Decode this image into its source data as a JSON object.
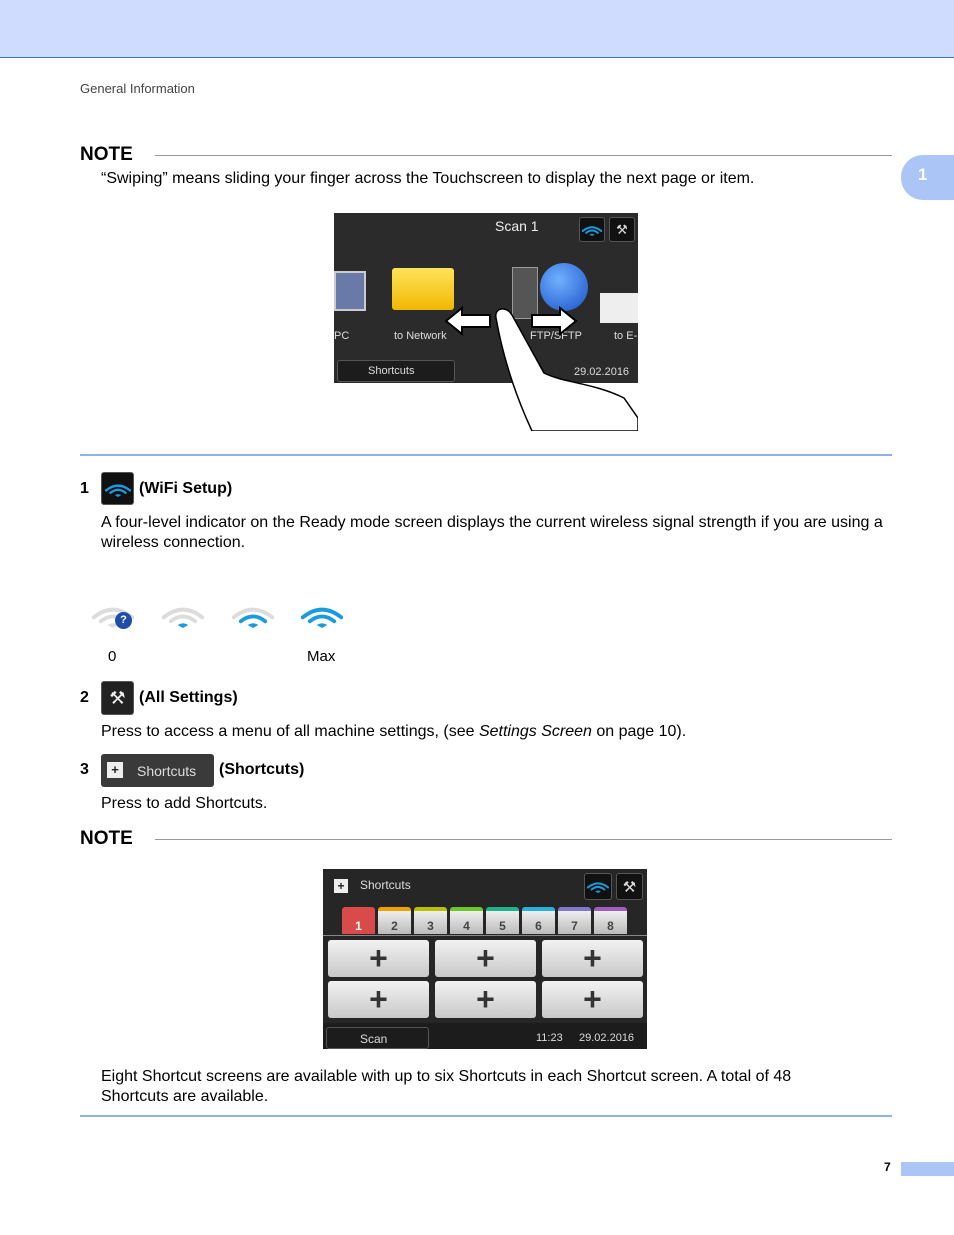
{
  "header": {
    "breadcrumb": "General Information",
    "chapter_tab": "1"
  },
  "note1": {
    "title": "NOTE",
    "text": "“Swiping” means sliding your finger across the Touchscreen to display the next page or item.",
    "screen": {
      "title": "Scan 1",
      "items": [
        "PC",
        "to Network",
        "FTP/SFTP",
        "to E-mail Server"
      ],
      "shortcuts_label": "Shortcuts",
      "date": "29.02.2016"
    }
  },
  "items": [
    {
      "number": "1",
      "icon": "wifi-icon",
      "title": "(WiFi Setup)",
      "text": "A four-level indicator on the Ready mode screen displays the current wireless signal strength if you are using a wireless connection.",
      "levels": [
        0,
        1,
        2,
        3
      ],
      "scale_min": "0",
      "scale_max": "Max"
    },
    {
      "number": "2",
      "icon": "settings-tools-icon",
      "title": "(All Settings)",
      "text_before": "Press to access a menu of all machine settings, (see ",
      "text_link": "Settings Screen",
      "text_after": " on page 10)."
    },
    {
      "number": "3",
      "icon": "shortcuts-icon",
      "button_label": "Shortcuts",
      "title": "(Shortcuts)",
      "text": "Press to add Shortcuts."
    }
  ],
  "note2": {
    "title": "NOTE",
    "screen": {
      "title": "Shortcuts",
      "tabs": [
        {
          "label": "1",
          "color": "#d94a4a"
        },
        {
          "label": "2",
          "color": "#f0a000"
        },
        {
          "label": "3",
          "color": "#b8c000"
        },
        {
          "label": "4",
          "color": "#6cc82a"
        },
        {
          "label": "5",
          "color": "#1db38c"
        },
        {
          "label": "6",
          "color": "#2ab0dc"
        },
        {
          "label": "7",
          "color": "#7b78d0"
        },
        {
          "label": "8",
          "color": "#a25cc0"
        }
      ],
      "plus": "+",
      "scan_label": "Scan",
      "time": "11:23",
      "date": "29.02.2016"
    },
    "text": "Eight Shortcut screens are available with up to six Shortcuts in each Shortcut screen. A total of 48 Shortcuts are available."
  },
  "footer": {
    "page_number": "7"
  },
  "colors": {
    "accent": "#8fb0ea",
    "wifi": "#1a9ae0",
    "wifi_off": "#dcdcdc"
  }
}
